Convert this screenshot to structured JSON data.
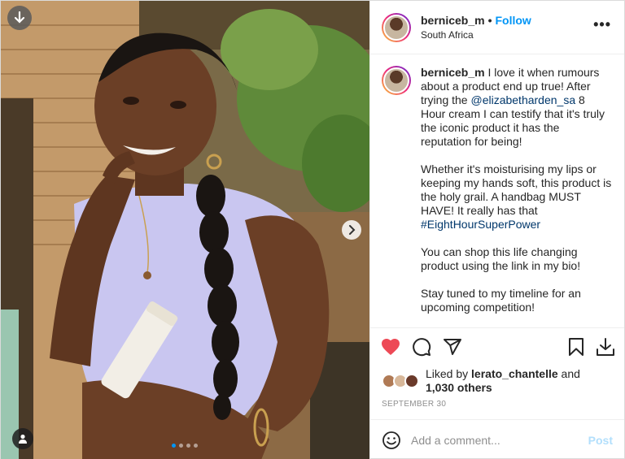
{
  "header": {
    "username": "berniceb_m",
    "separator": "•",
    "follow_label": "Follow",
    "location": "South Africa",
    "more_label": "•••"
  },
  "caption": {
    "username": "berniceb_m",
    "p1_before": "I love it when rumours about a product end up true! After trying the",
    "p1_mention": "@elizabetharden_sa",
    "p1_after": "8 Hour cream I can testify that it's truly the iconic product it has the reputation for being!",
    "p2_before": "Whether it's moisturising my lips or keeping my hands soft, this product is the holy grail. A handbag MUST HAVE! It really has that",
    "p2_hashtag": "#EightHourSuperPower",
    "p3": "You can shop this life changing product using the link in my bio!",
    "p4": "Stay tuned to my timeline for an upcoming competition!"
  },
  "actions": {
    "icons": [
      "heart-filled-icon",
      "comment-icon",
      "share-icon",
      "bookmark-icon",
      "download-icon"
    ],
    "like_color": "#ed4956"
  },
  "likes": {
    "prefix": "Liked by",
    "user": "lerato_chantelle",
    "middle": "and",
    "others": "1,030 others"
  },
  "date": "SEPTEMBER 30",
  "comment": {
    "placeholder": "Add a comment...",
    "post_label": "Post"
  },
  "carousel": {
    "current": 1,
    "total": 4
  }
}
